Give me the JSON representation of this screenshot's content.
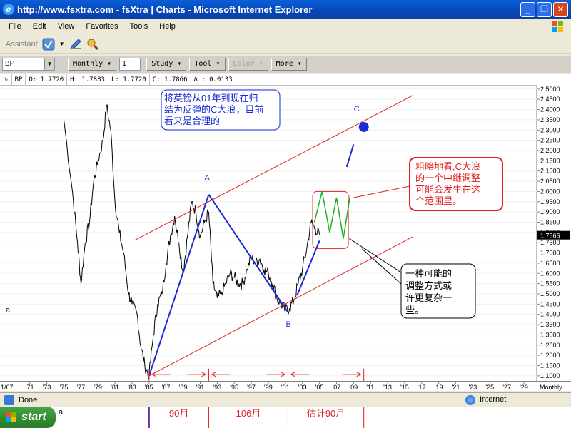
{
  "window": {
    "title": "http://www.fsxtra.com - fsXtra | Charts - Microsoft Internet Explorer",
    "minimize": "_",
    "maximize": "❐",
    "close": "✕"
  },
  "menu": [
    "File",
    "Edit",
    "View",
    "Favorites",
    "Tools",
    "Help"
  ],
  "toolbar": {
    "assistant_label": "Assistant"
  },
  "chart_toolbar": {
    "symbol": "BP",
    "period": "Monthly",
    "count": "1",
    "study": "Study",
    "tool": "Tool",
    "color": "Color",
    "more": "More"
  },
  "info": {
    "symbol": "BP",
    "open": "O: 1.7720",
    "high": "H: 1.7883",
    "low": "L: 1.7720",
    "close": "C: 1.7866",
    "delta": "Δ : 0.0133"
  },
  "status": {
    "left": "Done",
    "right": "Internet"
  },
  "taskbar": {
    "start": "start",
    "label_a": "a"
  },
  "annotations": {
    "note1_line1": "将英镑从01年到现在归",
    "note1_line2": "结为反弹的C大浪，目前",
    "note1_line3": "看来是合理的",
    "note2_line1": "粗略地看,C大浪",
    "note2_line2": "的一个中继调整",
    "note2_line3": "可能会发生在这",
    "note2_line4": "个范围里。",
    "note3_line1": "一种可能的",
    "note3_line2": "调整方式或",
    "note3_line3": "许更复杂一",
    "note3_line4": "些。",
    "wave_a": "A",
    "wave_b": "B",
    "wave_c": "C",
    "left_a": "a",
    "span1": "90月",
    "span2": "106月",
    "span3": "估计90月",
    "current_price": "1.7866",
    "date_label": "1/67",
    "monthly_label": "Monthly"
  },
  "chart_data": {
    "type": "line",
    "series": [
      {
        "name": "BP",
        "x": [
          1975,
          1976,
          1976.6,
          1977,
          1977.5,
          1978,
          1978.5,
          1979,
          1979.6,
          1980,
          1980.5,
          1981,
          1981.5,
          1982,
          1982.6,
          1983,
          1983.6,
          1984,
          1984.5,
          1985,
          1985.5,
          1986,
          1986.5,
          1987,
          1987.5,
          1988,
          1988.5,
          1989,
          1989.5,
          1990,
          1990.5,
          1991,
          1991.5,
          1992,
          1992.5,
          1993,
          1993.5,
          1994,
          1994.5,
          1995,
          1995.5,
          1996,
          1996.5,
          1997,
          1997.5,
          1998,
          1998.5,
          1999,
          1999.5,
          2000,
          2000.5,
          2001,
          2001.5,
          2002,
          2002.5,
          2003,
          2003.5,
          2004,
          2004.5,
          2005
        ],
        "y": [
          2.35,
          2.0,
          1.75,
          1.55,
          1.75,
          1.85,
          2.05,
          2.15,
          2.25,
          2.42,
          2.3,
          1.95,
          1.8,
          1.7,
          1.5,
          1.45,
          1.4,
          1.25,
          1.15,
          1.1,
          1.3,
          1.45,
          1.5,
          1.65,
          1.78,
          1.88,
          1.75,
          1.6,
          1.78,
          1.95,
          1.9,
          1.78,
          1.85,
          1.9,
          1.55,
          1.48,
          1.5,
          1.55,
          1.6,
          1.58,
          1.55,
          1.55,
          1.62,
          1.68,
          1.65,
          1.67,
          1.62,
          1.6,
          1.55,
          1.48,
          1.45,
          1.42,
          1.43,
          1.47,
          1.55,
          1.62,
          1.72,
          1.85,
          1.82,
          1.79
        ]
      }
    ],
    "xlabels": [
      "'71",
      "'73",
      "'75",
      "'77",
      "'79",
      "'81",
      "'83",
      "'85",
      "'87",
      "'89",
      "'91",
      "'93",
      "'95",
      "'97",
      "'99",
      "'01",
      "'03",
      "'05",
      "'07",
      "'09",
      "'11",
      "'13",
      "'15",
      "'17",
      "'19",
      "'21",
      "'23",
      "'25",
      "'27",
      "'29"
    ],
    "ylabels": [
      "2.5000",
      "2.4500",
      "2.4000",
      "2.3500",
      "2.3000",
      "2.2500",
      "2.2000",
      "2.1500",
      "2.1000",
      "2.0500",
      "2.0000",
      "1.9500",
      "1.9000",
      "1.8500",
      "1.8000",
      "1.7500",
      "1.7000",
      "1.6500",
      "1.6000",
      "1.5500",
      "1.5000",
      "1.4500",
      "1.4000",
      "1.3500",
      "1.3000",
      "1.2500",
      "1.2000",
      "1.1500",
      "1.1000"
    ],
    "ylim": [
      1.075,
      2.51
    ],
    "xlim": [
      1967.5,
      2030.5
    ],
    "waves": {
      "a_start": [
        1985.0,
        1.1
      ],
      "a_peak": [
        1992.0,
        1.985
      ],
      "b_low": [
        2001.3,
        1.41
      ],
      "c_target": [
        2010.2,
        2.315
      ]
    },
    "colors": {
      "price": "#000000",
      "wave": "#1a2bd6",
      "channel": "#e02020",
      "note_border": "#1a2bd6",
      "note2_border": "#e02020"
    }
  }
}
